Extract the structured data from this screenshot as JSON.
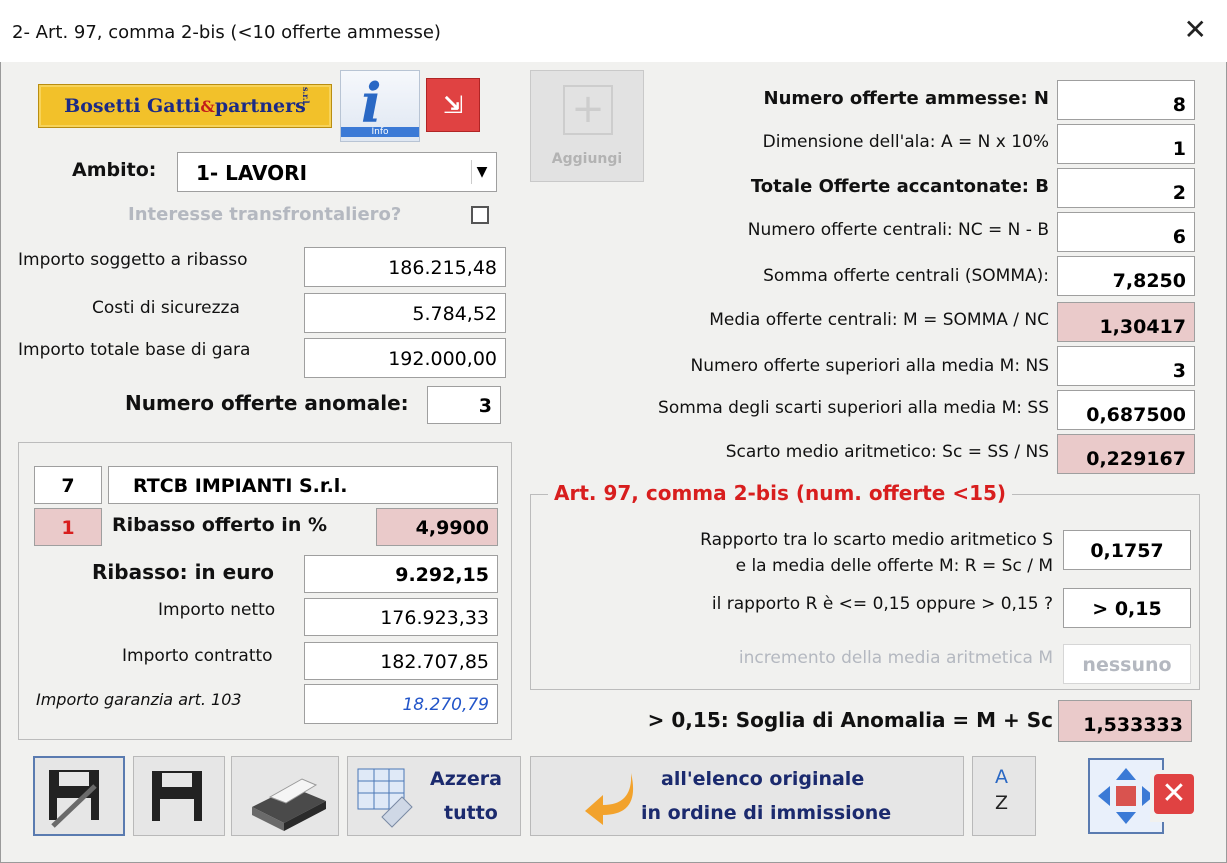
{
  "window": {
    "title": "2- Art. 97, comma 2-bis (<10 offerte ammesse)",
    "close": "✕"
  },
  "logo": {
    "text_a": "Bosetti Gatti",
    "amp": "&",
    "text_b": "partners",
    "suffix": "s.r.l."
  },
  "info_button": {
    "label": "Info"
  },
  "add_button": {
    "label": "Aggiungi"
  },
  "ambito": {
    "label": "Ambito:",
    "value": "1- LAVORI"
  },
  "interesse": {
    "label": "Interesse transfrontaliero?"
  },
  "importi": {
    "soggetto_label": "Importo soggetto a ribasso",
    "soggetto_value": "186.215,48",
    "sicurezza_label": "Costi di sicurezza",
    "sicurezza_value": "5.784,52",
    "totale_label": "Importo totale base di gara",
    "totale_value": "192.000,00"
  },
  "anomale": {
    "label": "Numero offerte anomale:",
    "value": "3"
  },
  "offerta": {
    "numero": "7",
    "nome": "RTCB IMPIANTI S.r.l.",
    "rank": "1",
    "ribasso_pct_label": "Ribasso offerto in %",
    "ribasso_pct": "4,9900",
    "ribasso_euro_label": "Ribasso: in euro",
    "ribasso_euro": "9.292,15",
    "netto_label": "Importo netto",
    "netto": "176.923,33",
    "contratto_label": "Importo contratto",
    "contratto": "182.707,85",
    "garanzia_label": "Importo garanzia art. 103",
    "garanzia": "18.270,79"
  },
  "calcoli": [
    {
      "label": "Numero offerte ammesse: N",
      "value": "8"
    },
    {
      "label": "Dimensione dell'ala: A = N x 10%",
      "value": "1"
    },
    {
      "label": "Totale Offerte accantonate: B",
      "value": "2"
    },
    {
      "label": "Numero offerte centrali: NC = N - B",
      "value": "6"
    },
    {
      "label": "Somma offerte centrali (SOMMA):",
      "value": "7,8250"
    },
    {
      "label": "Media offerte centrali: M = SOMMA / NC",
      "value": "1,30417"
    },
    {
      "label": "Numero offerte superiori alla media M: NS",
      "value": "3"
    },
    {
      "label": "Somma degli scarti superiori alla media M: SS",
      "value": "0,687500"
    },
    {
      "label": "Scarto medio aritmetico: Sc = SS / NS",
      "value": "0,229167"
    }
  ],
  "art97": {
    "title": "Art. 97, comma 2-bis (num. offerte <15)",
    "rapporto_label_1": "Rapporto tra lo scarto medio aritmetico S",
    "rapporto_label_2": "e la media delle offerte M: R = Sc / M",
    "rapporto_value": "0,1757",
    "confronto_label": "il rapporto R è <= 0,15 oppure > 0,15 ?",
    "confronto_value": "> 0,15",
    "incremento_label": "incremento della media aritmetica M",
    "incremento_value": "nessuno"
  },
  "soglia": {
    "label": "> 0,15: Soglia di Anomalia = M + Sc",
    "value": "1,533333"
  },
  "toolbar": {
    "azzera_1": "Azzera",
    "azzera_2": "tutto",
    "elenco_1": "all'elenco originale",
    "elenco_2": "in ordine di immissione",
    "sort_a": "A",
    "sort_z": "Z"
  }
}
